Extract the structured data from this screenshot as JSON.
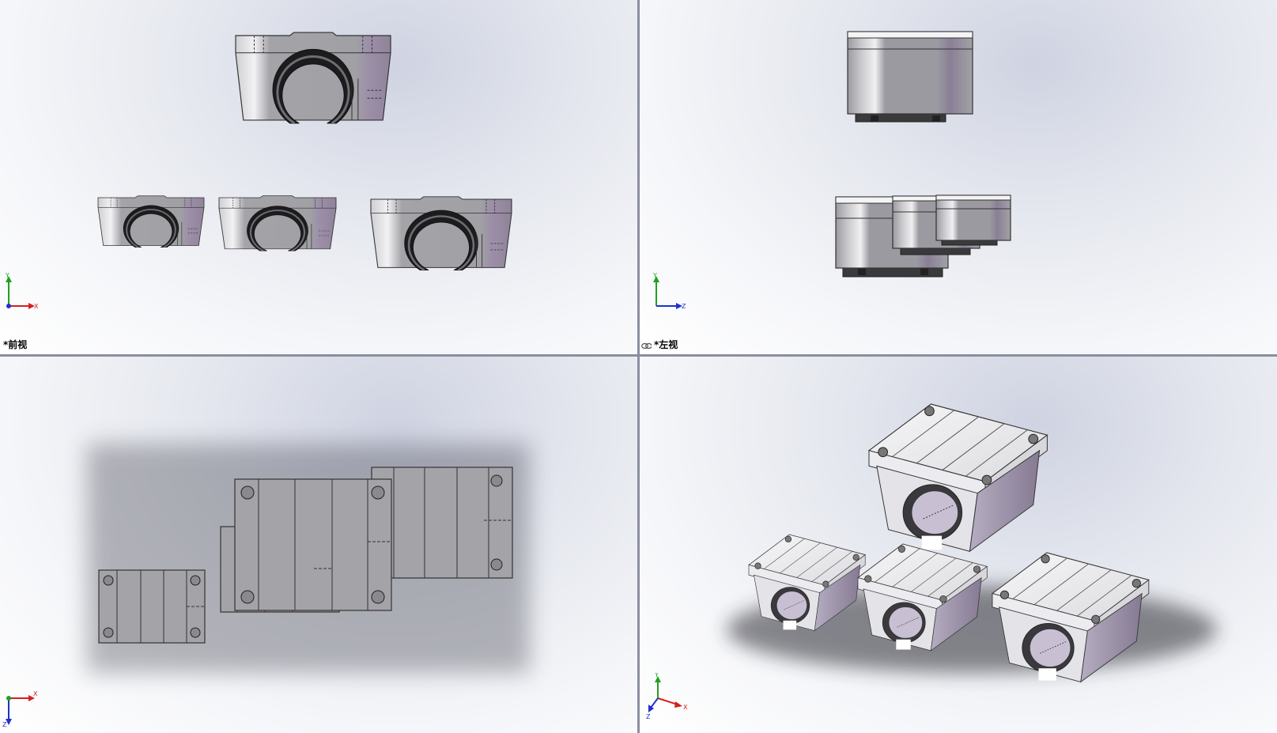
{
  "viewports": {
    "front": {
      "label": "*前视",
      "triad_axes": [
        "Y",
        "X"
      ]
    },
    "left": {
      "label": "*左视",
      "triad_axes": [
        "Y",
        "Z"
      ]
    },
    "top": {
      "label": "",
      "triad_axes": [
        "X",
        "Z"
      ]
    },
    "iso": {
      "label": "",
      "triad_axes": [
        "Y",
        "X",
        "Z"
      ]
    }
  },
  "icons": {
    "link": "link-icon",
    "triad": "coordinate-triad-icon"
  },
  "colors": {
    "x_axis": "#d42020",
    "y_axis": "#20a020",
    "z_axis": "#2030d0",
    "part_body": "#9a9a9e",
    "part_shade": "#8a7f96",
    "part_highlight": "#e8e8ec",
    "splitter": "#8a8fa0"
  }
}
